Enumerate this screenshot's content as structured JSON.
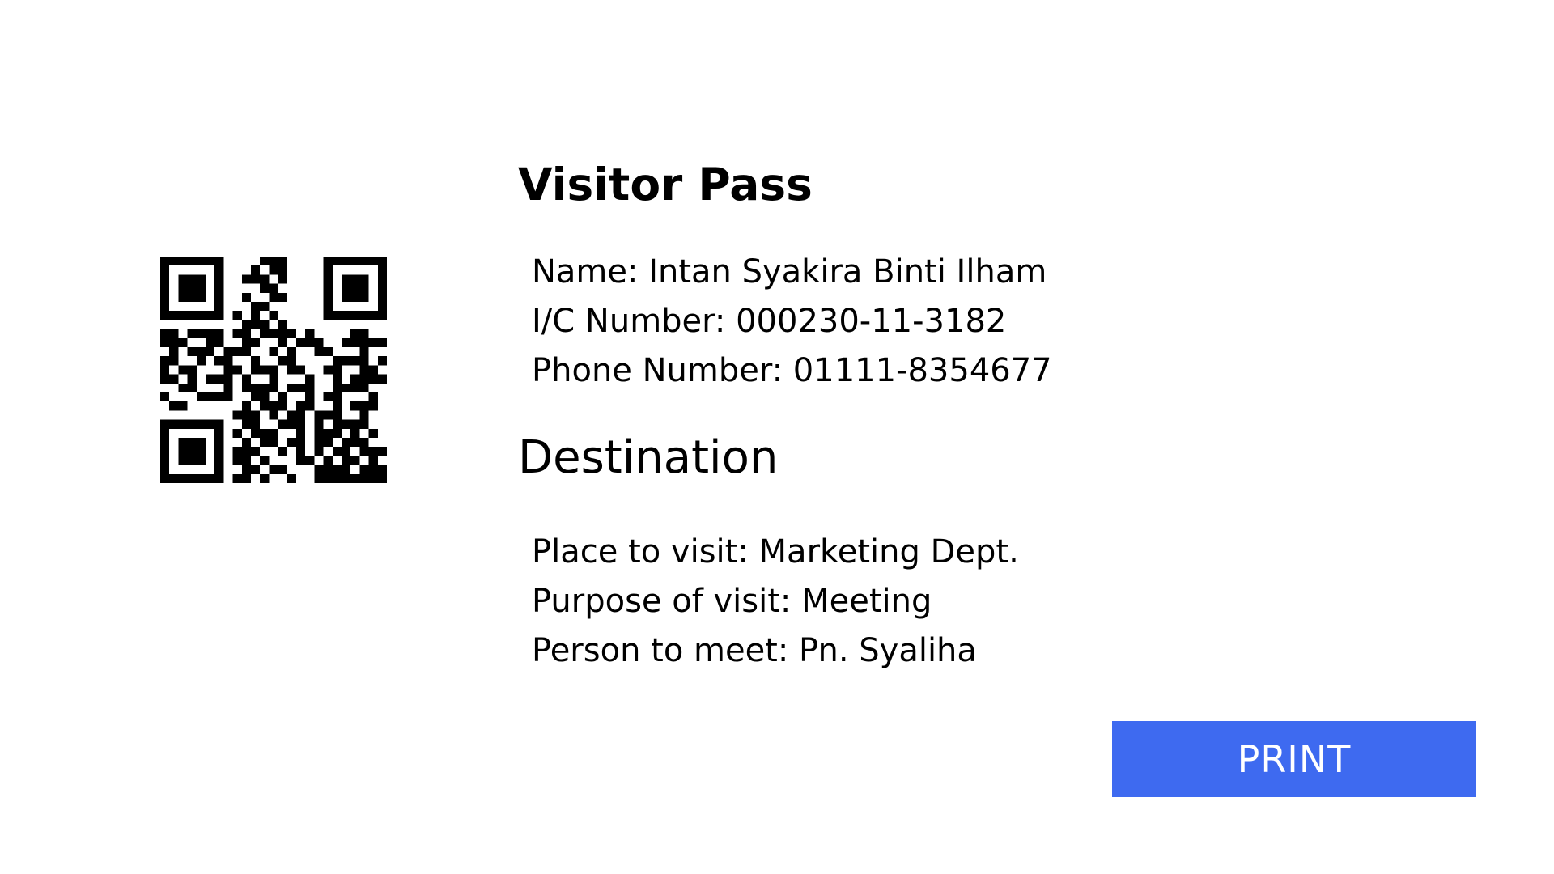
{
  "pass": {
    "title": "Visitor Pass",
    "qr_icon": "qr-code-icon",
    "visitor": {
      "name": "Name: Intan Syakira Binti Ilham",
      "ic_number": "I/C Number: 000230-11-3182",
      "phone": "Phone Number: 01111-8354677"
    },
    "destination": {
      "heading": "Destination",
      "place": "Place to visit: Marketing Dept.",
      "purpose": "Purpose of visit: Meeting",
      "person": "Person to meet: Pn. Syaliha"
    }
  },
  "actions": {
    "print_label": "PRINT"
  },
  "colors": {
    "accent": "#3e6af0",
    "text": "#000000",
    "background": "#ffffff"
  }
}
